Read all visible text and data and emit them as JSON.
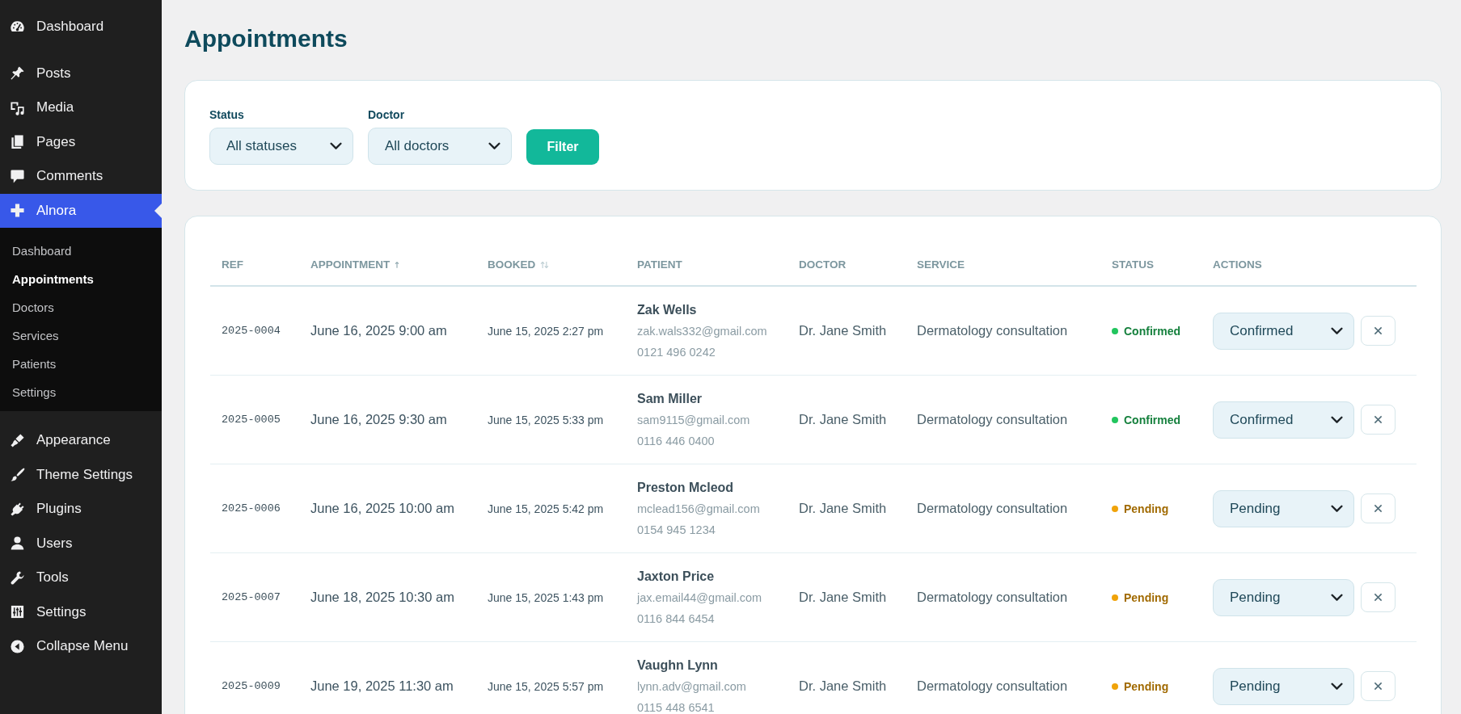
{
  "sidebar": {
    "groups": [
      {
        "items": [
          {
            "label": "Dashboard",
            "selected": false
          }
        ]
      },
      {
        "items": [
          {
            "label": "Posts",
            "selected": false
          },
          {
            "label": "Media",
            "selected": false
          },
          {
            "label": "Pages",
            "selected": false
          },
          {
            "label": "Comments",
            "selected": false
          },
          {
            "label": "Alnora",
            "selected": true,
            "children": [
              {
                "label": "Dashboard",
                "selected": false
              },
              {
                "label": "Appointments",
                "selected": true
              },
              {
                "label": "Doctors",
                "selected": false
              },
              {
                "label": "Services",
                "selected": false
              },
              {
                "label": "Patients",
                "selected": false
              },
              {
                "label": "Settings",
                "selected": false
              }
            ]
          }
        ]
      },
      {
        "items": [
          {
            "label": "Appearance",
            "selected": false
          },
          {
            "label": "Theme Settings",
            "selected": false
          },
          {
            "label": "Plugins",
            "selected": false
          },
          {
            "label": "Users",
            "selected": false
          },
          {
            "label": "Tools",
            "selected": false
          },
          {
            "label": "Settings",
            "selected": false
          }
        ]
      }
    ],
    "collapse_label": "Collapse Menu"
  },
  "page": {
    "title": "Appointments"
  },
  "filters": {
    "fields": [
      {
        "label": "Status",
        "value": "All statuses"
      },
      {
        "label": "Doctor",
        "value": "All doctors"
      }
    ],
    "button": "Filter"
  },
  "table": {
    "columns": [
      {
        "label": "REF",
        "sortable": false,
        "sorted": false
      },
      {
        "label": "APPOINTMENT",
        "sortable": true,
        "sorted": true
      },
      {
        "label": "BOOKED",
        "sortable": true,
        "sorted": false
      },
      {
        "label": "PATIENT",
        "sortable": false,
        "sorted": false
      },
      {
        "label": "DOCTOR",
        "sortable": false,
        "sorted": false
      },
      {
        "label": "SERVICE",
        "sortable": false,
        "sorted": false
      },
      {
        "label": "STATUS",
        "sortable": false,
        "sorted": false
      },
      {
        "label": "ACTIONS",
        "sortable": false,
        "sorted": false
      }
    ],
    "rows": [
      {
        "ref": "2025-0004",
        "appointment": "June 16, 2025 9:00 am",
        "booked": "June 15, 2025 2:27 pm",
        "patient": {
          "name": "Zak Wells",
          "email": "zak.wals332@gmail.com",
          "phone": "0121 496 0242"
        },
        "doctor": "Dr. Jane Smith",
        "service": "Dermatology consultation",
        "status": {
          "label": "Confirmed",
          "kind": "confirmed",
          "color": "#22c55e"
        },
        "action": "Confirmed"
      },
      {
        "ref": "2025-0005",
        "appointment": "June 16, 2025 9:30 am",
        "booked": "June 15, 2025 5:33 pm",
        "patient": {
          "name": "Sam Miller",
          "email": "sam9115@gmail.com",
          "phone": "0116 446 0400"
        },
        "doctor": "Dr. Jane Smith",
        "service": "Dermatology consultation",
        "status": {
          "label": "Confirmed",
          "kind": "confirmed",
          "color": "#22c55e"
        },
        "action": "Confirmed"
      },
      {
        "ref": "2025-0006",
        "appointment": "June 16, 2025 10:00 am",
        "booked": "June 15, 2025 5:42 pm",
        "patient": {
          "name": "Preston Mcleod",
          "email": "mclead156@gmail.com",
          "phone": "0154 945 1234"
        },
        "doctor": "Dr. Jane Smith",
        "service": "Dermatology consultation",
        "status": {
          "label": "Pending",
          "kind": "pending",
          "color": "#f0a30a"
        },
        "action": "Pending"
      },
      {
        "ref": "2025-0007",
        "appointment": "June 18, 2025 10:30 am",
        "booked": "June 15, 2025 1:43 pm",
        "patient": {
          "name": "Jaxton Price",
          "email": "jax.email44@gmail.com",
          "phone": "0116 844 6454"
        },
        "doctor": "Dr. Jane Smith",
        "service": "Dermatology consultation",
        "status": {
          "label": "Pending",
          "kind": "pending",
          "color": "#f0a30a"
        },
        "action": "Pending"
      },
      {
        "ref": "2025-0009",
        "appointment": "June 19, 2025 11:30 am",
        "booked": "June 15, 2025 5:57 pm",
        "patient": {
          "name": "Vaughn Lynn",
          "email": "lynn.adv@gmail.com",
          "phone": "0115 448 6541"
        },
        "doctor": "Dr. Jane Smith",
        "service": "Dermatology consultation",
        "status": {
          "label": "Pending",
          "kind": "pending",
          "color": "#f0a30a"
        },
        "action": "Pending"
      }
    ]
  }
}
